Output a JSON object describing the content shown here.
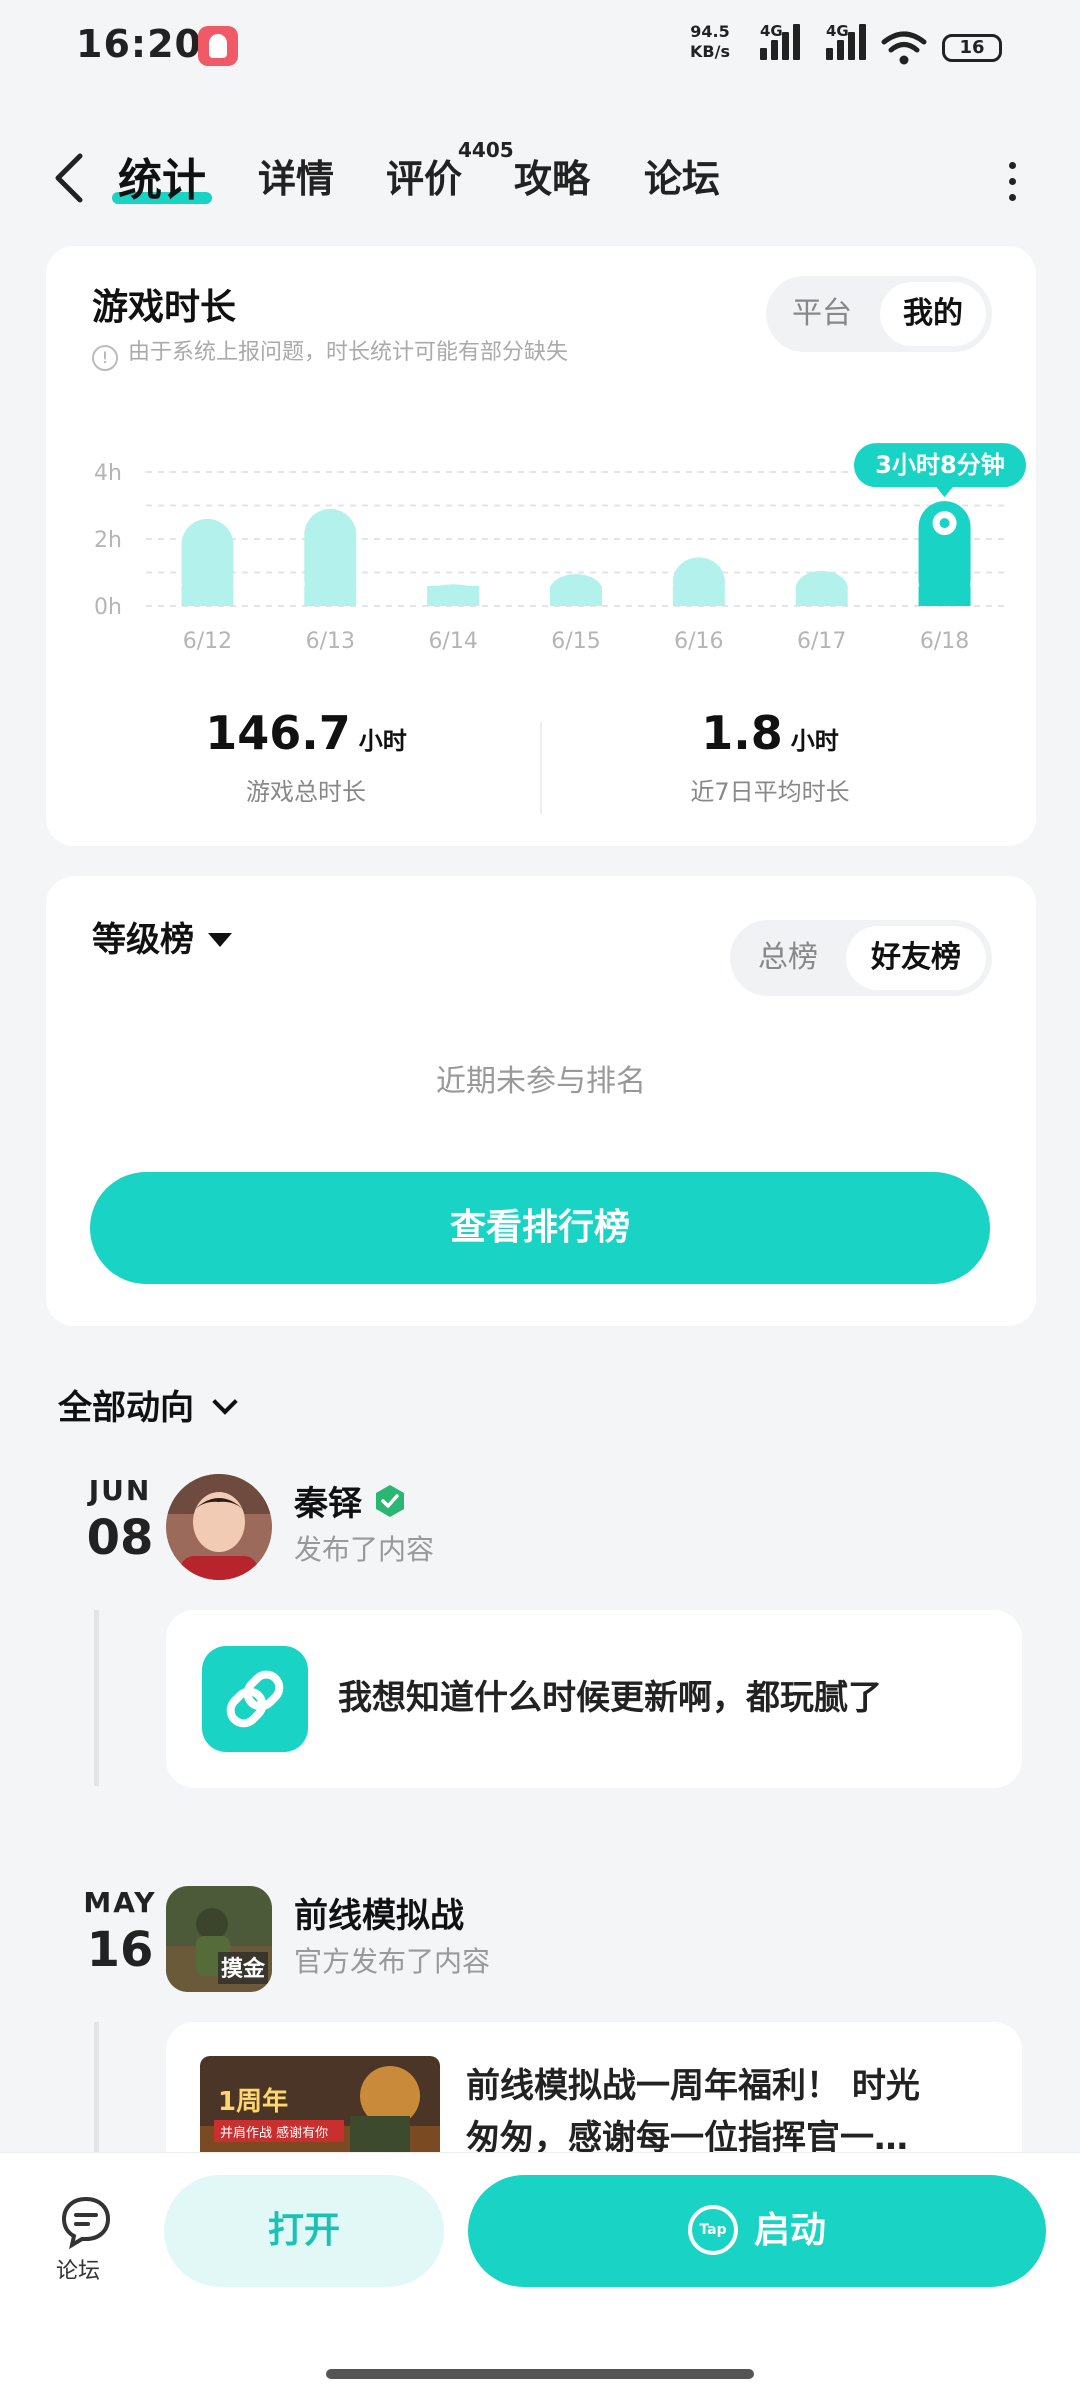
{
  "status_bar": {
    "time": "16:20",
    "net_speed_value": "94.5",
    "net_speed_unit": "KB/s",
    "signal1_label": "4G",
    "signal2_label": "4G",
    "battery": "16"
  },
  "tabs": {
    "items": [
      "统计",
      "详情",
      "评价",
      "攻略",
      "论坛"
    ],
    "active": "统计",
    "review_count": "4405"
  },
  "playtime": {
    "title": "游戏时长",
    "note": "由于系统上报问题，时长统计可能有部分缺失",
    "toggle": [
      "平台",
      "我的"
    ],
    "toggle_selected": "我的",
    "highlight_label": "3小时8分钟",
    "total_value": "146.7",
    "total_unit": "小时",
    "total_label": "游戏总时长",
    "avg_value": "1.8",
    "avg_unit": "小时",
    "avg_label": "近7日平均时长"
  },
  "chart_data": {
    "type": "bar",
    "categories": [
      "6/12",
      "6/13",
      "6/14",
      "6/15",
      "6/16",
      "6/17",
      "6/18"
    ],
    "values": [
      2.6,
      2.9,
      0.65,
      0.95,
      1.45,
      1.05,
      3.13
    ],
    "unit": "h",
    "yticks": [
      "0h",
      "2h",
      "4h"
    ],
    "ylim": [
      0,
      4
    ],
    "highlight_index": 6,
    "colors": {
      "bar": "#b3f1ec",
      "highlight": "#19d3c5"
    },
    "grid": true
  },
  "ranking": {
    "title": "等级榜",
    "toggle": [
      "总榜",
      "好友榜"
    ],
    "toggle_selected": "好友榜",
    "empty_text": "近期未参与排名",
    "button_label": "查看排行榜"
  },
  "feed": {
    "header": "全部动向",
    "posts": [
      {
        "month": "JUN",
        "day": "08",
        "author": "秦铎",
        "action": "发布了内容",
        "text": "我想知道什么时候更新啊，都玩腻了"
      },
      {
        "month": "MAY",
        "day": "16",
        "author": "前线模拟战",
        "action": "官方发布了内容",
        "text_line1": "前线模拟战一周年福利！ 时光",
        "text_line2": "匆匆，感谢每一位指挥官一…",
        "thumb_badge": "1周年",
        "thumb_sub": "并肩作战 感谢有你",
        "avatar_badge": "摸金"
      }
    ]
  },
  "bottom_bar": {
    "forum_label": "论坛",
    "open_label": "打开",
    "start_label": "启动",
    "tap_logo": "Tap"
  },
  "colors": {
    "accent": "#19d3c5",
    "accent_light": "#b3f1ec"
  }
}
